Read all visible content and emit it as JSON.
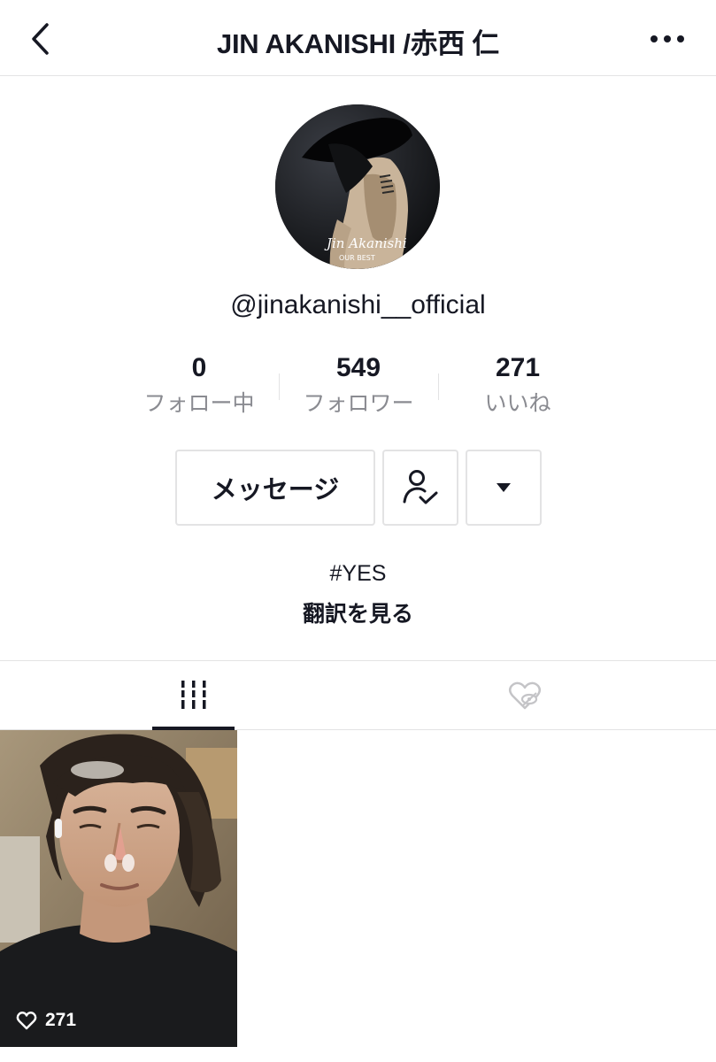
{
  "header": {
    "title": "JIN AKANISHI /赤西 仁",
    "back_icon": "chevron-left-icon",
    "more_icon": "ellipsis-icon"
  },
  "profile": {
    "avatar_caption": "Jin Akanishi",
    "avatar_subcaption": "OUR BEST",
    "username": "@jinakanishi__official",
    "bio": "#YES",
    "translate_link": "翻訳を見る"
  },
  "stats": [
    {
      "value": "0",
      "label": "フォロー中"
    },
    {
      "value": "549",
      "label": "フォロワー"
    },
    {
      "value": "271",
      "label": "いいね"
    }
  ],
  "actions": {
    "message_label": "メッセージ",
    "follow_icon": "user-check-icon",
    "dropdown_icon": "caret-down-icon"
  },
  "tabs": [
    {
      "name": "videos",
      "icon": "grid-bars-icon",
      "active": true
    },
    {
      "name": "liked",
      "icon": "hidden-heart-icon",
      "active": false
    }
  ],
  "videos": [
    {
      "likes": "271",
      "like_icon": "heart-outline-icon"
    }
  ],
  "colors": {
    "text": "#161823",
    "secondary_text": "#8a8b91",
    "divider": "#e3e3e4",
    "background": "#ffffff"
  }
}
